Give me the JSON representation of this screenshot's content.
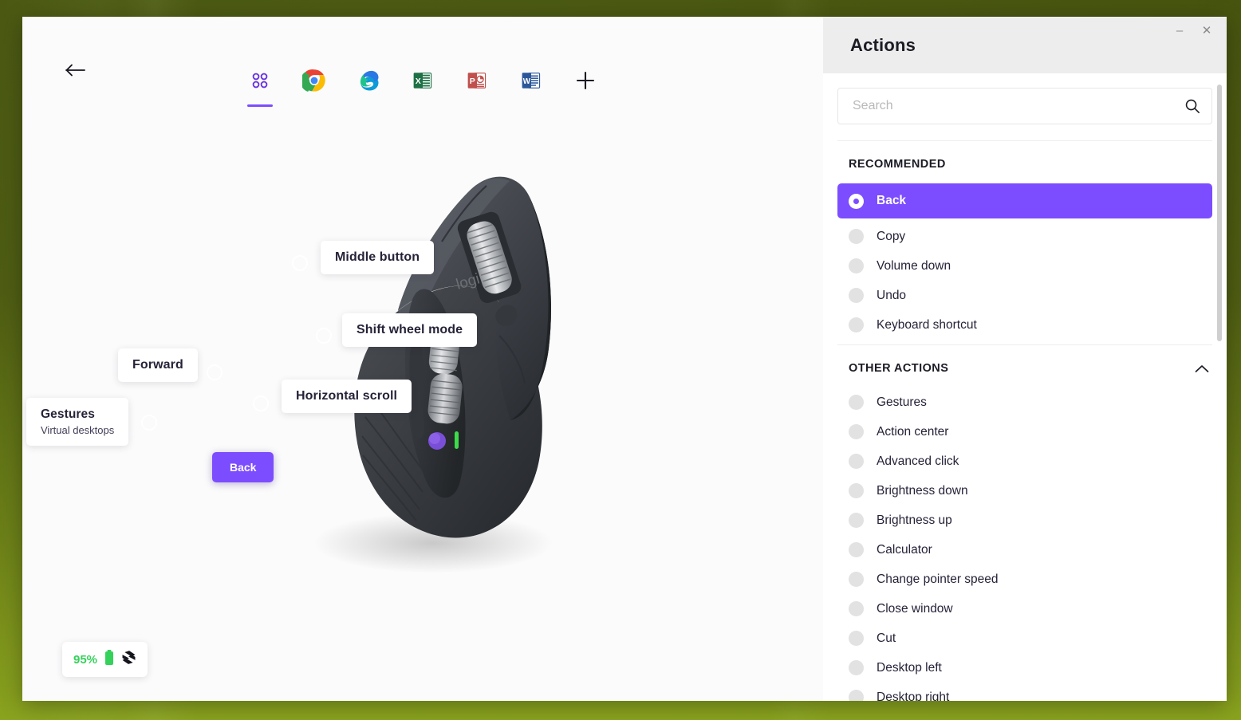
{
  "window": {
    "controls": {
      "minimize": "–",
      "close": "✕"
    }
  },
  "left": {
    "back_button_icon": "arrow-left-icon",
    "app_tabs": [
      {
        "id": "all-apps",
        "label": "All applications",
        "icon": "grid-dots-icon",
        "active": true
      },
      {
        "id": "chrome",
        "label": "Google Chrome",
        "icon": "chrome-icon",
        "active": false
      },
      {
        "id": "edge",
        "label": "Microsoft Edge",
        "icon": "edge-icon",
        "active": false
      },
      {
        "id": "excel",
        "label": "Microsoft Excel",
        "icon": "excel-icon",
        "active": false
      },
      {
        "id": "powerpoint",
        "label": "Microsoft PowerPoint",
        "icon": "powerpoint-icon",
        "active": false
      },
      {
        "id": "word",
        "label": "Microsoft Word",
        "icon": "word-icon",
        "active": false
      },
      {
        "id": "add",
        "label": "Add application",
        "icon": "plus-icon",
        "active": false
      }
    ],
    "callouts": [
      {
        "id": "middle-button",
        "title": "Middle button",
        "sub": ""
      },
      {
        "id": "shift-wheel-mode",
        "title": "Shift wheel mode",
        "sub": ""
      },
      {
        "id": "forward",
        "title": "Forward",
        "sub": ""
      },
      {
        "id": "horizontal-scroll",
        "title": "Horizontal scroll",
        "sub": ""
      },
      {
        "id": "gestures",
        "title": "Gestures",
        "sub": "Virtual desktops"
      }
    ],
    "assigned_chip": {
      "label": "Back"
    },
    "device_brand_mark": "logi",
    "battery": {
      "percent": "95%",
      "battery_icon": "battery-full-icon",
      "flow_icon": "logitech-flow-icon",
      "percent_color": "#35d15a"
    }
  },
  "panel": {
    "title": "Actions",
    "search": {
      "value": "",
      "placeholder": "Search",
      "icon": "search-icon"
    },
    "sections": [
      {
        "id": "recommended",
        "heading": "RECOMMENDED",
        "collapsible": false,
        "chevron": "",
        "items": [
          {
            "label": "Back",
            "selected": true
          },
          {
            "label": "Copy",
            "selected": false
          },
          {
            "label": "Volume down",
            "selected": false
          },
          {
            "label": "Undo",
            "selected": false
          },
          {
            "label": "Keyboard shortcut",
            "selected": false
          }
        ]
      },
      {
        "id": "other-actions",
        "heading": "OTHER ACTIONS",
        "collapsible": true,
        "chevron": "chevron-up-icon",
        "items": [
          {
            "label": "Gestures",
            "selected": false
          },
          {
            "label": "Action center",
            "selected": false
          },
          {
            "label": "Advanced click",
            "selected": false
          },
          {
            "label": "Brightness down",
            "selected": false
          },
          {
            "label": "Brightness up",
            "selected": false
          },
          {
            "label": "Calculator",
            "selected": false
          },
          {
            "label": "Change pointer speed",
            "selected": false
          },
          {
            "label": "Close window",
            "selected": false
          },
          {
            "label": "Cut",
            "selected": false
          },
          {
            "label": "Desktop left",
            "selected": false
          },
          {
            "label": "Desktop right",
            "selected": false
          }
        ]
      }
    ]
  },
  "colors": {
    "accent_purple": "#7c4dff",
    "panel_header_bg": "#ededed",
    "battery_green": "#35d15a",
    "desktop_green": "#4e5d12"
  }
}
